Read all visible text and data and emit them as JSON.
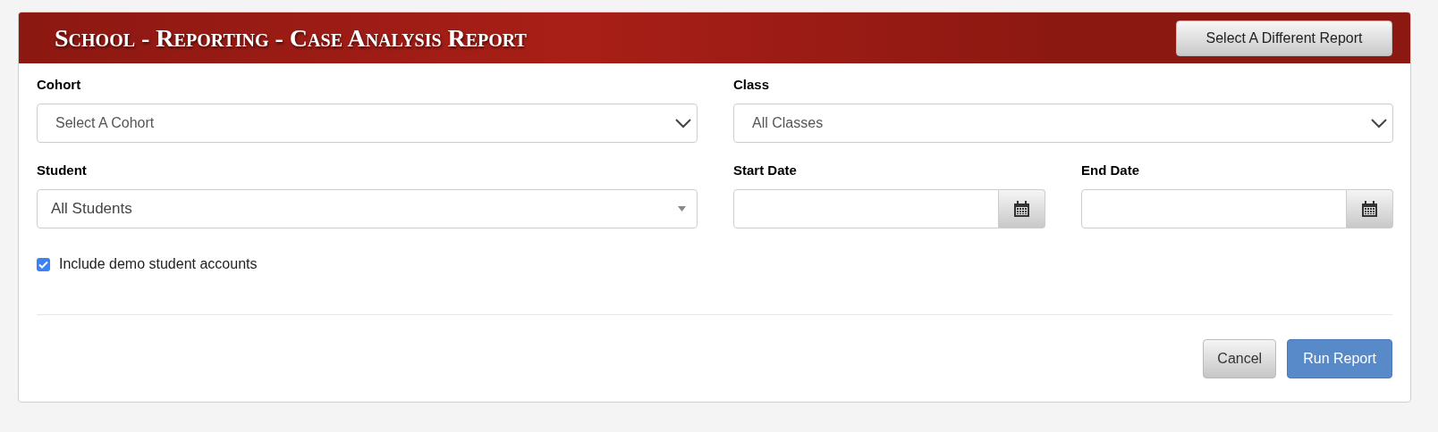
{
  "header": {
    "title": "School - Reporting - Case Analysis Report",
    "button": "Select A Different Report"
  },
  "fields": [
    {
      "kind": "select",
      "label": "Cohort",
      "value": "Select A Cohort"
    },
    {
      "kind": "select",
      "label": "Class",
      "value": "All Classes"
    },
    {
      "kind": "plain-select",
      "label": "Student",
      "value": "All Students"
    },
    {
      "kind": "date",
      "label": "Start Date"
    },
    {
      "kind": "date",
      "label": "End Date"
    }
  ],
  "checkbox": {
    "label": "Include demo student accounts",
    "checked": true
  },
  "buttons": [
    {
      "label": "Cancel",
      "kind": "secondary"
    },
    {
      "label": "Run Report",
      "kind": "primary"
    }
  ]
}
